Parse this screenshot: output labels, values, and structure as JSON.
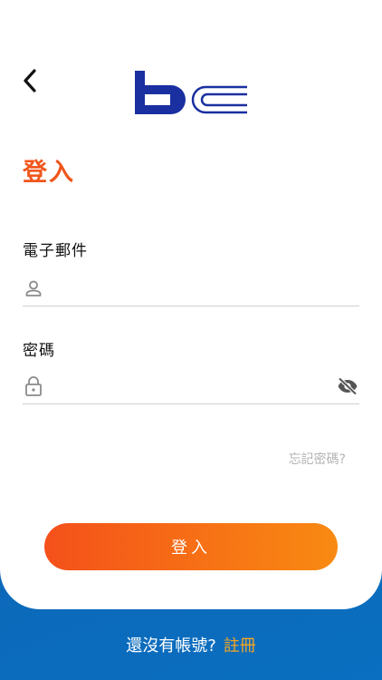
{
  "header": {
    "back_icon": "chevron-left-icon",
    "logo_text": "bc"
  },
  "page": {
    "title": "登入"
  },
  "form": {
    "email_label": "電子郵件",
    "email_value": "",
    "email_placeholder": "",
    "email_icon": "person-icon",
    "password_label": "密碼",
    "password_value": "",
    "password_placeholder": "",
    "password_icon": "lock-icon",
    "visibility_icon": "eye-off-icon",
    "forgot_label": "忘記密碼?"
  },
  "actions": {
    "login_label": "登入"
  },
  "footer": {
    "prompt": "還沒有帳號?",
    "register_label": "註冊"
  },
  "colors": {
    "accent": "#f0561c",
    "brand_blue": "#1a2fa0",
    "register": "#f5a623",
    "background": "#0e63b5"
  }
}
